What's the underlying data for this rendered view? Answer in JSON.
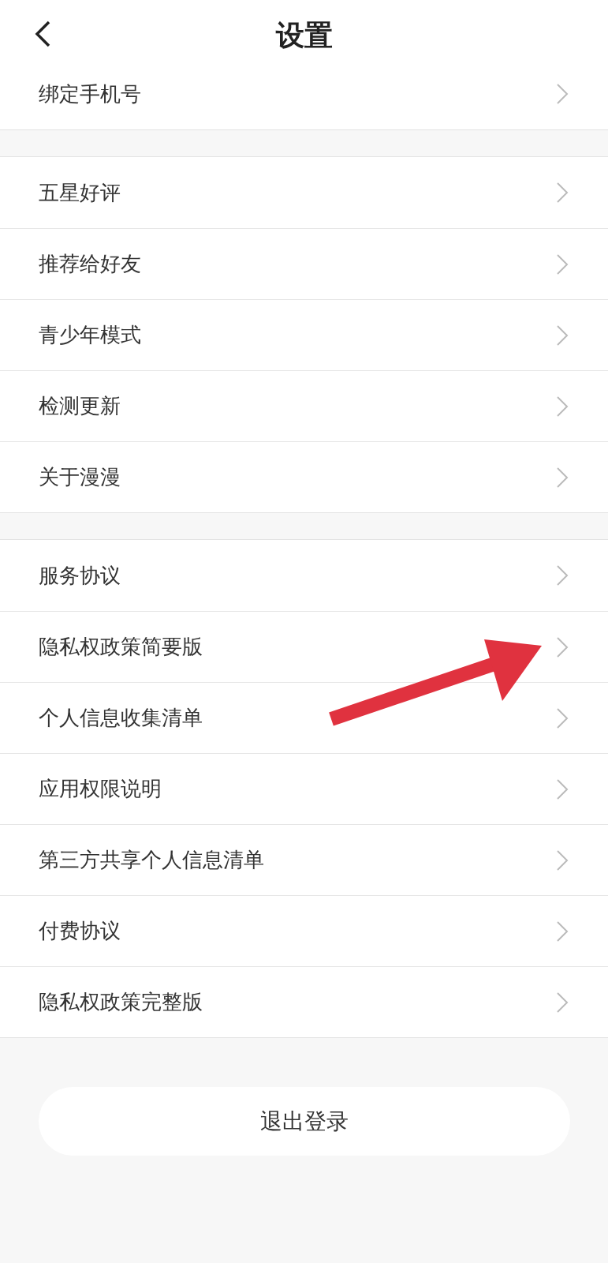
{
  "header": {
    "title": "设置"
  },
  "groups": [
    {
      "items": [
        {
          "label": "绑定手机号"
        }
      ]
    },
    {
      "items": [
        {
          "label": "五星好评"
        },
        {
          "label": "推荐给好友"
        },
        {
          "label": "青少年模式"
        },
        {
          "label": "检测更新"
        },
        {
          "label": "关于漫漫"
        }
      ]
    },
    {
      "items": [
        {
          "label": "服务协议"
        },
        {
          "label": "隐私权政策简要版"
        },
        {
          "label": "个人信息收集清单"
        },
        {
          "label": "应用权限说明"
        },
        {
          "label": "第三方共享个人信息清单"
        },
        {
          "label": "付费协议"
        },
        {
          "label": "隐私权政策完整版"
        }
      ]
    }
  ],
  "logout_button": "退出登录"
}
